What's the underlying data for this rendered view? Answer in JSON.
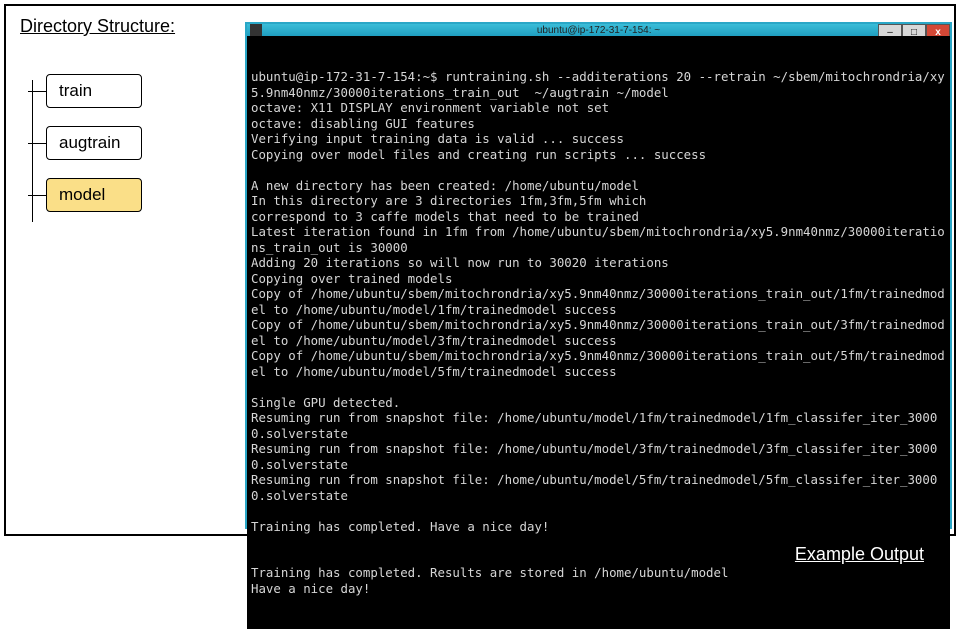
{
  "sidebar": {
    "title": "Directory Structure:",
    "items": [
      {
        "label": "train",
        "selected": false
      },
      {
        "label": "augtrain",
        "selected": false
      },
      {
        "label": "model",
        "selected": true
      }
    ]
  },
  "terminal": {
    "title": "ubuntu@ip-172-31-7-154: ~",
    "buttons": {
      "min": "–",
      "max": "□",
      "close": "x"
    },
    "lines": [
      "ubuntu@ip-172-31-7-154:~$ runtraining.sh --additerations 20 --retrain ~/sbem/mitochrondria/xy5.9nm40nmz/30000iterations_train_out  ~/augtrain ~/model",
      "octave: X11 DISPLAY environment variable not set",
      "octave: disabling GUI features",
      "Verifying input training data is valid ... success",
      "Copying over model files and creating run scripts ... success",
      "",
      "A new directory has been created: /home/ubuntu/model",
      "In this directory are 3 directories 1fm,3fm,5fm which",
      "correspond to 3 caffe models that need to be trained",
      "Latest iteration found in 1fm from /home/ubuntu/sbem/mitochrondria/xy5.9nm40nmz/30000iterations_train_out is 30000",
      "Adding 20 iterations so will now run to 30020 iterations",
      "Copying over trained models",
      "Copy of /home/ubuntu/sbem/mitochrondria/xy5.9nm40nmz/30000iterations_train_out/1fm/trainedmodel to /home/ubuntu/model/1fm/trainedmodel success",
      "Copy of /home/ubuntu/sbem/mitochrondria/xy5.9nm40nmz/30000iterations_train_out/3fm/trainedmodel to /home/ubuntu/model/3fm/trainedmodel success",
      "Copy of /home/ubuntu/sbem/mitochrondria/xy5.9nm40nmz/30000iterations_train_out/5fm/trainedmodel to /home/ubuntu/model/5fm/trainedmodel success",
      "",
      "Single GPU detected.",
      "Resuming run from snapshot file: /home/ubuntu/model/1fm/trainedmodel/1fm_classifer_iter_30000.solverstate",
      "Resuming run from snapshot file: /home/ubuntu/model/3fm/trainedmodel/3fm_classifer_iter_30000.solverstate",
      "Resuming run from snapshot file: /home/ubuntu/model/5fm/trainedmodel/5fm_classifer_iter_30000.solverstate",
      "",
      "Training has completed. Have a nice day!",
      "",
      "",
      "Training has completed. Results are stored in /home/ubuntu/model",
      "Have a nice day!"
    ]
  },
  "overlay": {
    "example_label": "Example Output"
  }
}
